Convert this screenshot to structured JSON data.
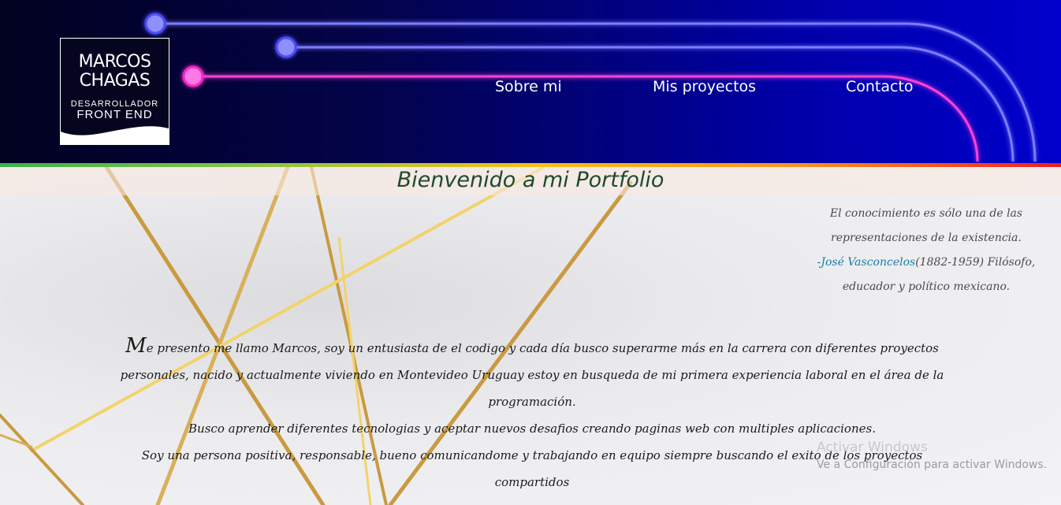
{
  "logo": {
    "line1": "MARCOS",
    "line2": "CHAGAS",
    "sub1": "DESARROLLADOR",
    "sub2": "FRONT END"
  },
  "nav": {
    "about": "Sobre mi",
    "projects": "Mis proyectos",
    "contact": "Contacto"
  },
  "hero": {
    "title": "Bienvenido a mi Portfolio"
  },
  "quote": {
    "line1": "El conocimiento es sólo una de las",
    "line2": "representaciones de la existencia.",
    "author_prefix": "-",
    "author_name": "José Vasconcelos",
    "author_detail": "(1882-1959) Filósofo,",
    "line4": "educador y político mexicano."
  },
  "bio": {
    "first_letter": "M",
    "p1_rest": "e presento me llamo Marcos, soy un entusiasta de el codigo y cada día busco superarme más en la carrera con diferentes proyectos personales, nacido y actualmente viviendo en Montevideo Uruguay estoy en busqueda de mi primera experiencia laboral en el área de la programación.",
    "p2": "Busco aprender diferentes tecnologias y aceptar nuevos desafios creando paginas web con multiples aplicaciones.",
    "p3": "Soy una persona positiva, responsable, bueno comunicandome y trabajando en equipo siempre buscando el exito de los proyectos compartidos"
  },
  "os_watermark": {
    "line1": "Activar Windows",
    "line2": "Ve a Configuración para activar Windows."
  },
  "colors": {
    "neon_blue": "#7b7bff",
    "neon_pink": "#ff40d8",
    "title_green": "#1f4a2a",
    "link_blue": "#1a7ca8",
    "gold": "#d4a84a"
  }
}
